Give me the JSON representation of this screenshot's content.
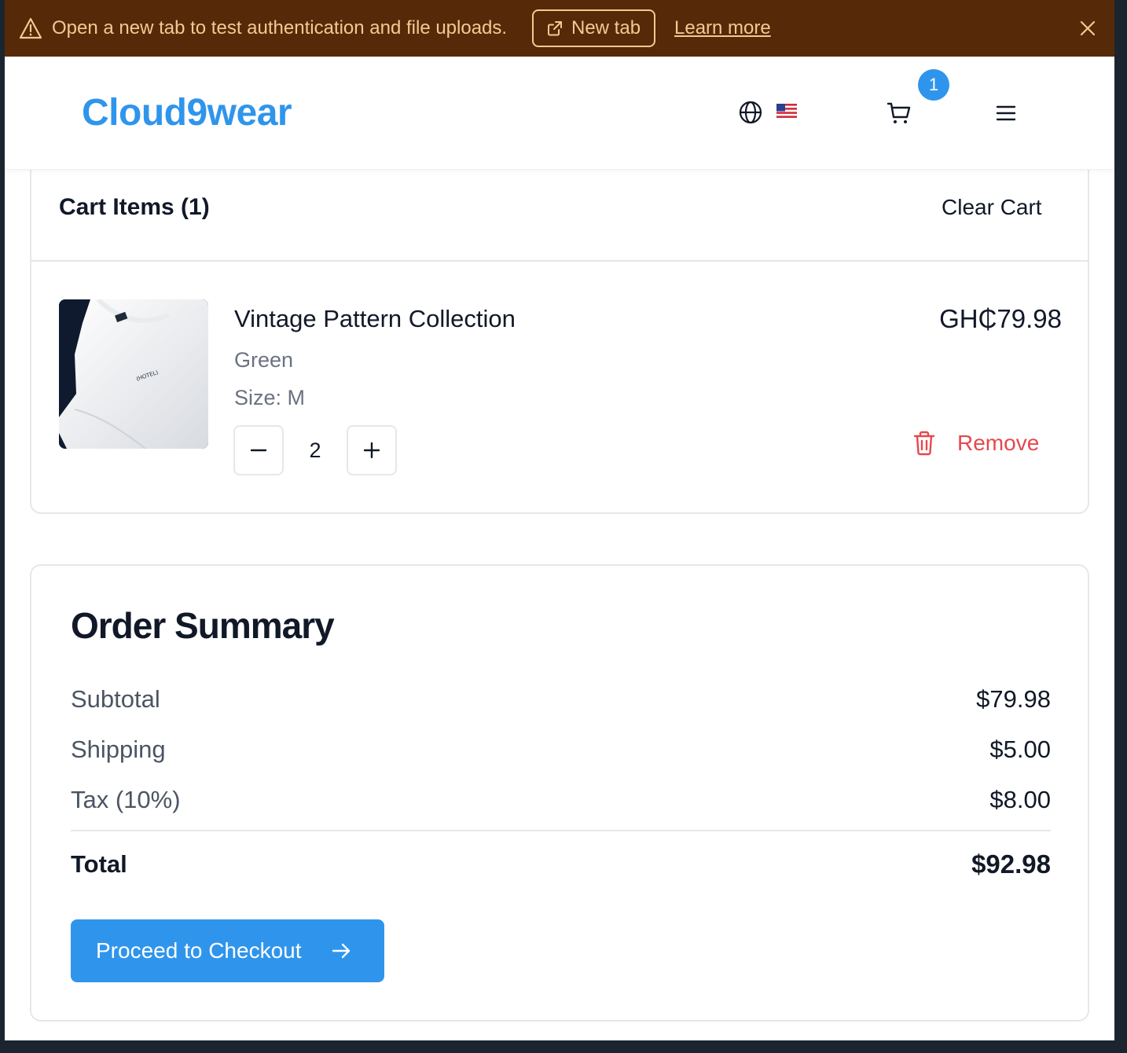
{
  "banner": {
    "message": "Open a new tab to test authentication and file uploads.",
    "new_tab_label": "New tab",
    "learn_more_label": "Learn more",
    "bg_color": "#562a08",
    "text_color": "#f6c892"
  },
  "header": {
    "logo": "Cloud9wear",
    "cart_count": "1",
    "brand_color": "#2f95ec"
  },
  "cart": {
    "title": "Cart Items (1)",
    "clear_label": "Clear Cart",
    "item": {
      "name": "Vintage Pattern Collection",
      "color": "Green",
      "size": "Size: M",
      "quantity": "2",
      "price": "GH₵79.98",
      "remove_label": "Remove",
      "image_label": "(HOTEL)"
    }
  },
  "summary": {
    "title": "Order Summary",
    "subtotal_label": "Subtotal",
    "subtotal_value": "$79.98",
    "shipping_label": "Shipping",
    "shipping_value": "$5.00",
    "tax_label": "Tax (10%)",
    "tax_value": "$8.00",
    "total_label": "Total",
    "total_value": "$92.98",
    "checkout_label": "Proceed to Checkout"
  }
}
